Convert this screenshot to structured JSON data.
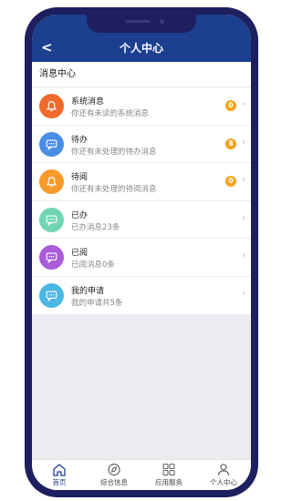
{
  "header": {
    "back_glyph": "<",
    "title": "个人中心"
  },
  "section": {
    "title": "消息中心"
  },
  "messages": [
    {
      "title": "系统消息",
      "subtitle": "你还有未读的系统消息",
      "badge": "0",
      "icon": "bell-icon",
      "color": "#ef6b2c"
    },
    {
      "title": "待办",
      "subtitle": "你还有未处理的待办消息",
      "badge": "8",
      "icon": "chat-icon",
      "color": "#4a8de4"
    },
    {
      "title": "待阅",
      "subtitle": "你还有未处理的待阅消息",
      "badge": "0",
      "icon": "bell-icon",
      "color": "#f59a2b"
    },
    {
      "title": "已办",
      "subtitle": "已办消息23条",
      "badge": "",
      "icon": "chat-icon",
      "color": "#6fd6b1"
    },
    {
      "title": "已阅",
      "subtitle": "已阅消息0条",
      "badge": "",
      "icon": "chat-icon",
      "color": "#a95bd8"
    },
    {
      "title": "我的申请",
      "subtitle": "我的申请共5条",
      "badge": "",
      "icon": "chat-icon",
      "color": "#4bb8e3"
    }
  ],
  "tabs": [
    {
      "label": "首页",
      "icon": "home-icon",
      "active": true
    },
    {
      "label": "综合信息",
      "icon": "compass-icon",
      "active": false
    },
    {
      "label": "应用服务",
      "icon": "grid-icon",
      "active": false
    },
    {
      "label": "个人中心",
      "icon": "user-icon",
      "active": false
    }
  ],
  "colors": {
    "navbar": "#1c3f8f",
    "badge": "#f4a31a",
    "phone_frame": "#1e1f5e"
  }
}
